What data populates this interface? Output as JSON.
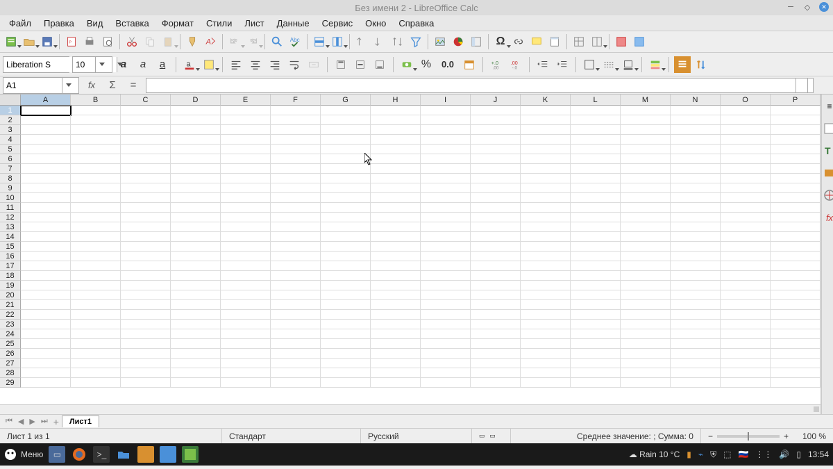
{
  "title": "Без имени 2 - LibreOffice Calc",
  "menubar": [
    "Файл",
    "Правка",
    "Вид",
    "Вставка",
    "Формат",
    "Стили",
    "Лист",
    "Данные",
    "Сервис",
    "Окно",
    "Справка"
  ],
  "font": {
    "name": "Liberation S",
    "size": "10"
  },
  "namebox": "A1",
  "columns": [
    "A",
    "B",
    "C",
    "D",
    "E",
    "F",
    "G",
    "H",
    "I",
    "J",
    "K",
    "L",
    "M",
    "N",
    "O",
    "P"
  ],
  "rows_visible": 29,
  "active_cell": "A1",
  "sheet_tab": "Лист1",
  "statusbar": {
    "sheet_count": "Лист 1 из 1",
    "style": "Стандарт",
    "lang": "Русский",
    "summary": "Среднее значение: ; Сумма: 0",
    "zoom": "100 %"
  },
  "format_labels": {
    "percent": "%",
    "number": "0.0"
  },
  "taskbar": {
    "menu": "Меню",
    "weather": "Rain 10 °C",
    "time": "13:54"
  }
}
